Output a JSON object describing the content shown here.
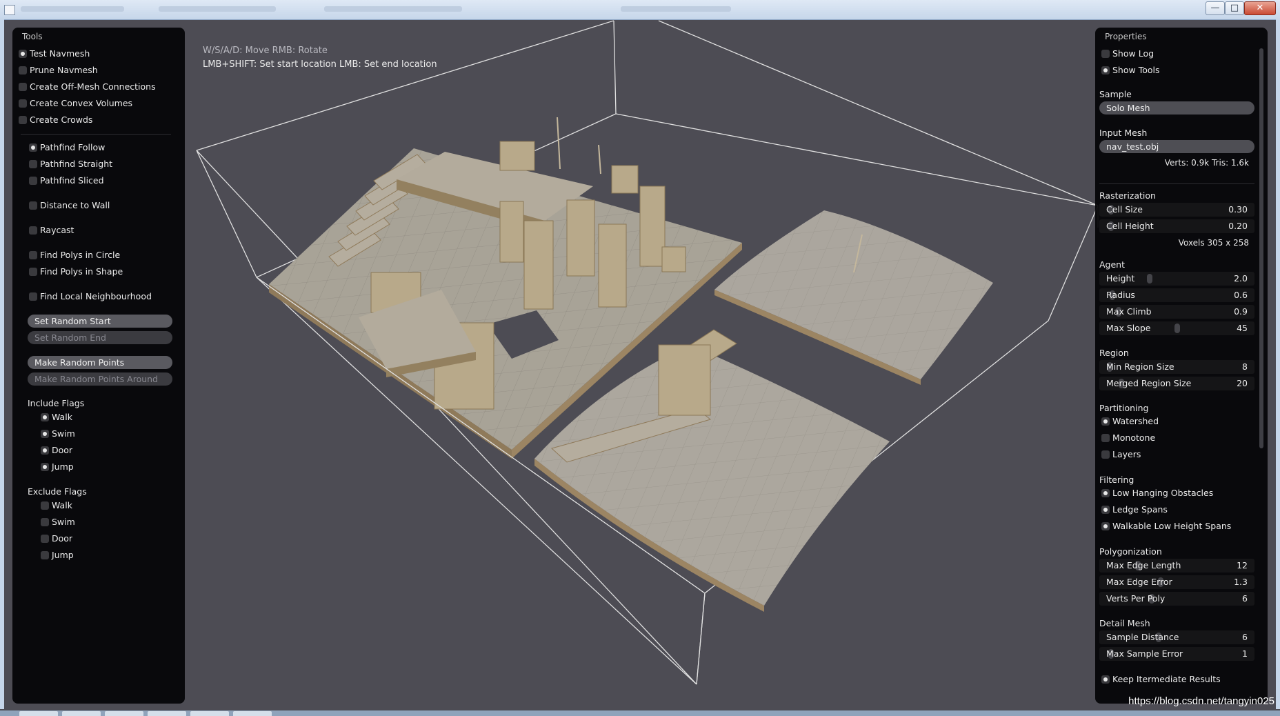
{
  "help": {
    "line1": "W/S/A/D: Move  RMB: Rotate",
    "line2": "LMB+SHIFT: Set start location  LMB: Set end location"
  },
  "window": {
    "min": "—",
    "max": "□",
    "close": "✕"
  },
  "tools": {
    "title": "Tools",
    "modes": [
      {
        "label": "Test Navmesh",
        "checked": true
      },
      {
        "label": "Prune Navmesh",
        "checked": false
      },
      {
        "label": "Create Off-Mesh Connections",
        "checked": false
      },
      {
        "label": "Create Convex Volumes",
        "checked": false
      },
      {
        "label": "Create Crowds",
        "checked": false
      }
    ],
    "tests": [
      {
        "label": "Pathfind Follow",
        "checked": true
      },
      {
        "label": "Pathfind Straight",
        "checked": false
      },
      {
        "label": "Pathfind Sliced",
        "checked": false
      },
      {
        "label": "Distance to Wall",
        "checked": false
      },
      {
        "label": "Raycast",
        "checked": false
      },
      {
        "label": "Find Polys in Circle",
        "checked": false
      },
      {
        "label": "Find Polys in Shape",
        "checked": false
      },
      {
        "label": "Find Local Neighbourhood",
        "checked": false
      }
    ],
    "buttons": {
      "set_random_start": "Set Random Start",
      "set_random_end": "Set Random End",
      "make_random_points": "Make Random Points",
      "make_random_points_around": "Make Random Points Around"
    },
    "include_title": "Include Flags",
    "include_flags": [
      {
        "label": "Walk",
        "checked": true
      },
      {
        "label": "Swim",
        "checked": true
      },
      {
        "label": "Door",
        "checked": true
      },
      {
        "label": "Jump",
        "checked": true
      }
    ],
    "exclude_title": "Exclude Flags",
    "exclude_flags": [
      {
        "label": "Walk",
        "checked": false
      },
      {
        "label": "Swim",
        "checked": false
      },
      {
        "label": "Door",
        "checked": false
      },
      {
        "label": "Jump",
        "checked": false
      }
    ]
  },
  "properties": {
    "title": "Properties",
    "show_log": {
      "label": "Show Log",
      "checked": false
    },
    "show_tools": {
      "label": "Show Tools",
      "checked": true
    },
    "sample_label": "Sample",
    "sample_value": "Solo Mesh",
    "input_mesh_label": "Input Mesh",
    "input_mesh_value": "nav_test.obj",
    "mesh_stats": "Verts: 0.9k  Tris: 1.6k",
    "rasterization": {
      "title": "Rasterization",
      "cell_size": {
        "label": "Cell Size",
        "value": "0.30",
        "fraction": 0.06
      },
      "cell_height": {
        "label": "Cell Height",
        "value": "0.20",
        "fraction": 0.06
      },
      "voxels": "Voxels  305 x 258"
    },
    "agent": {
      "title": "Agent",
      "height": {
        "label": "Height",
        "value": "2.0",
        "fraction": 0.32
      },
      "radius": {
        "label": "Radius",
        "value": "0.6",
        "fraction": 0.07
      },
      "max_climb": {
        "label": "Max Climb",
        "value": "0.9",
        "fraction": 0.11
      },
      "max_slope": {
        "label": "Max Slope",
        "value": "45",
        "fraction": 0.5
      }
    },
    "region": {
      "title": "Region",
      "min_region_size": {
        "label": "Min Region Size",
        "value": "8",
        "fraction": 0.05
      },
      "merged_region_size": {
        "label": "Merged Region Size",
        "value": "20",
        "fraction": 0.13
      }
    },
    "partitioning": {
      "title": "Partitioning",
      "options": [
        {
          "label": "Watershed",
          "checked": true
        },
        {
          "label": "Monotone",
          "checked": false
        },
        {
          "label": "Layers",
          "checked": false
        }
      ]
    },
    "filtering": {
      "title": "Filtering",
      "options": [
        {
          "label": "Low Hanging Obstacles",
          "checked": true
        },
        {
          "label": "Ledge Spans",
          "checked": true
        },
        {
          "label": "Walkable Low Height Spans",
          "checked": true
        }
      ]
    },
    "polygonization": {
      "title": "Polygonization",
      "max_edge_length": {
        "label": "Max Edge Length",
        "value": "12",
        "fraction": 0.24
      },
      "max_edge_error": {
        "label": "Max Edge Error",
        "value": "1.3",
        "fraction": 0.39
      },
      "verts_per_poly": {
        "label": "Verts Per Poly",
        "value": "6",
        "fraction": 0.33
      }
    },
    "detail_mesh": {
      "title": "Detail Mesh",
      "sample_distance": {
        "label": "Sample Distance",
        "value": "6",
        "fraction": 0.38
      },
      "max_sample_error": {
        "label": "Max Sample Error",
        "value": "1",
        "fraction": 0.06
      }
    },
    "keep_intermediate": {
      "label": "Keep Itermediate Results",
      "checked": true
    }
  },
  "watermark": "https://blog.csdn.net/tangyin025"
}
